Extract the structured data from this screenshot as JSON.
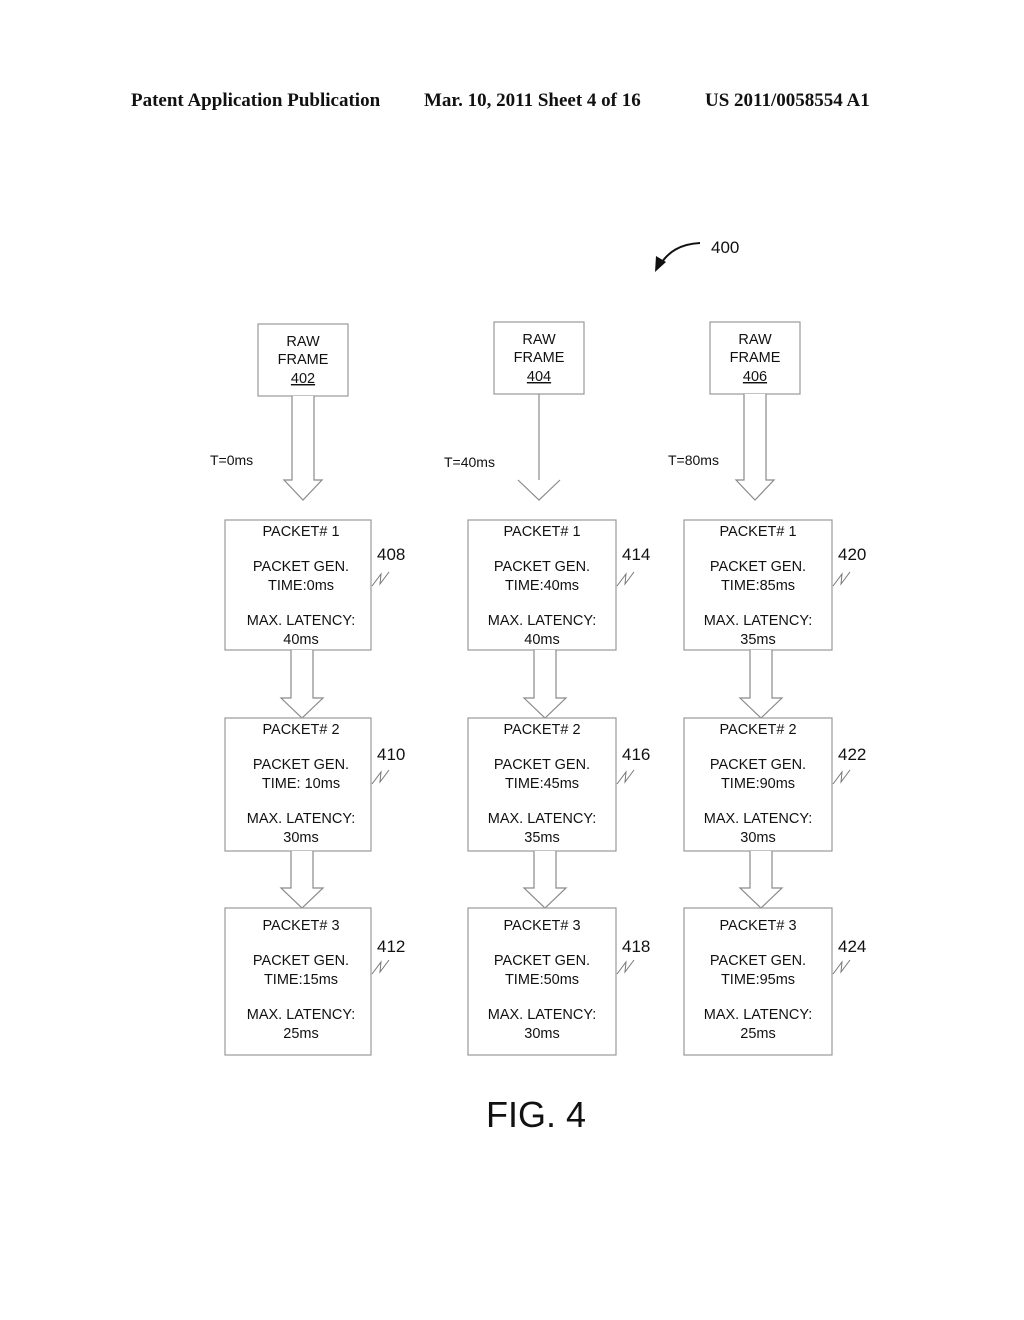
{
  "header": {
    "publication": "Patent Application Publication",
    "date_sheet": "Mar. 10, 2011  Sheet 4 of 16",
    "patent_number": "US 2011/0058554 A1"
  },
  "figure": {
    "ref": "400",
    "caption": "FIG. 4"
  },
  "columns": [
    {
      "raw_frame": {
        "line1": "RAW",
        "line2": "FRAME",
        "ref": "402"
      },
      "time_label": "T=0ms",
      "packets": [
        {
          "ref": "408",
          "title": "PACKET# 1",
          "gen_line1": "PACKET GEN.",
          "gen_line2": "TIME:0ms",
          "lat_line1": "MAX. LATENCY:",
          "lat_line2": "40ms"
        },
        {
          "ref": "410",
          "title": "PACKET# 2",
          "gen_line1": "PACKET GEN.",
          "gen_line2": "TIME: 10ms",
          "lat_line1": "MAX. LATENCY:",
          "lat_line2": "30ms"
        },
        {
          "ref": "412",
          "title": "PACKET# 3",
          "gen_line1": "PACKET GEN.",
          "gen_line2": "TIME:15ms",
          "lat_line1": "MAX. LATENCY:",
          "lat_line2": "25ms"
        }
      ]
    },
    {
      "raw_frame": {
        "line1": "RAW",
        "line2": "FRAME",
        "ref": "404"
      },
      "time_label": "T=40ms",
      "packets": [
        {
          "ref": "414",
          "title": "PACKET# 1",
          "gen_line1": "PACKET GEN.",
          "gen_line2": "TIME:40ms",
          "lat_line1": "MAX. LATENCY:",
          "lat_line2": "40ms"
        },
        {
          "ref": "416",
          "title": "PACKET# 2",
          "gen_line1": "PACKET GEN.",
          "gen_line2": "TIME:45ms",
          "lat_line1": "MAX. LATENCY:",
          "lat_line2": "35ms"
        },
        {
          "ref": "418",
          "title": "PACKET# 3",
          "gen_line1": "PACKET GEN.",
          "gen_line2": "TIME:50ms",
          "lat_line1": "MAX. LATENCY:",
          "lat_line2": "30ms"
        }
      ]
    },
    {
      "raw_frame": {
        "line1": "RAW",
        "line2": "FRAME",
        "ref": "406"
      },
      "time_label": "T=80ms",
      "packets": [
        {
          "ref": "420",
          "title": "PACKET# 1",
          "gen_line1": "PACKET GEN.",
          "gen_line2": "TIME:85ms",
          "lat_line1": "MAX. LATENCY:",
          "lat_line2": "35ms"
        },
        {
          "ref": "422",
          "title": "PACKET# 2",
          "gen_line1": "PACKET GEN.",
          "gen_line2": "TIME:90ms",
          "lat_line1": "MAX. LATENCY:",
          "lat_line2": "30ms"
        },
        {
          "ref": "424",
          "title": "PACKET# 3",
          "gen_line1": "PACKET GEN.",
          "gen_line2": "TIME:95ms",
          "lat_line1": "MAX. LATENCY:",
          "lat_line2": "25ms"
        }
      ]
    }
  ]
}
